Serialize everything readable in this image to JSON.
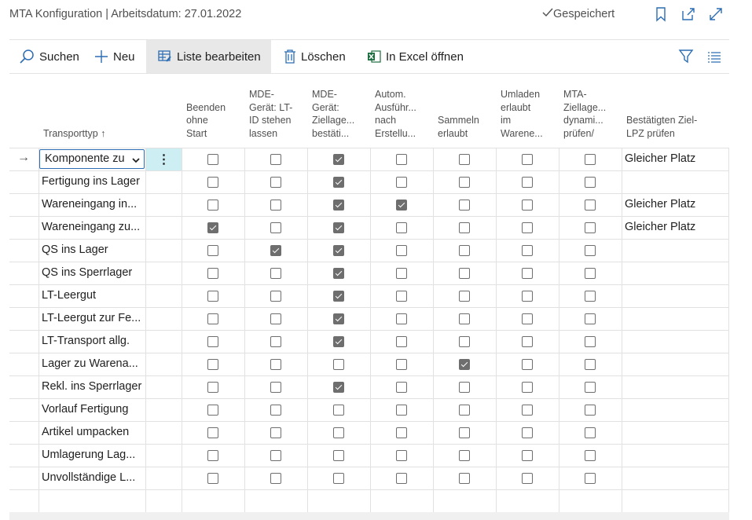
{
  "header": {
    "title": "MTA Konfiguration | Arbeitsdatum: 27.01.2022",
    "saved_status": "Gespeichert",
    "icons": [
      "bookmark-icon",
      "open-new-window-icon",
      "expand-icon"
    ]
  },
  "toolbar": {
    "search": "Suchen",
    "new": "Neu",
    "edit_list": "Liste bearbeiten",
    "delete": "Löschen",
    "excel": "In Excel öffnen",
    "right_icons": [
      "filter-icon",
      "list-options-icon"
    ]
  },
  "table": {
    "columns": [
      "Transporttyp ↑",
      "Beenden ohne Start",
      "MDE-Gerät: LT-ID stehen lassen",
      "MDE-Gerät: Ziellage... bestäti...",
      "Autom. Ausführ... nach Erstellu...",
      "Sammeln erlaubt",
      "Umladen erlaubt im Warene...",
      "MTA-Ziellage... dynami... prüfen/",
      "Bestätigten Ziel-LPZ prüfen"
    ],
    "column_header_lines": [
      [
        "Transporttyp ↑"
      ],
      [
        "Beenden",
        "ohne",
        "Start"
      ],
      [
        "MDE-",
        "Gerät: LT-",
        "ID stehen",
        "lassen"
      ],
      [
        "MDE-",
        "Gerät:",
        "Ziellage...",
        "bestäti..."
      ],
      [
        "Autom.",
        "Ausführ...",
        "nach",
        "Erstellu..."
      ],
      [
        "Sammeln",
        "erlaubt"
      ],
      [
        "Umladen",
        "erlaubt",
        "im",
        "Warene..."
      ],
      [
        "MTA-",
        "Ziellage...",
        "dynami...",
        "prüfen/"
      ],
      [
        "Bestätigten Ziel-",
        "LPZ prüfen"
      ]
    ],
    "rows": [
      {
        "type": "Komponente zu",
        "flags": [
          false,
          false,
          true,
          false,
          false,
          false,
          false
        ],
        "confirm": "Gleicher Platz",
        "selected": true
      },
      {
        "type": "Fertigung ins Lager",
        "flags": [
          false,
          false,
          true,
          false,
          false,
          false,
          false
        ],
        "confirm": ""
      },
      {
        "type": "Wareneingang in...",
        "flags": [
          false,
          false,
          true,
          true,
          false,
          false,
          false
        ],
        "confirm": "Gleicher Platz"
      },
      {
        "type": "Wareneingang zu...",
        "flags": [
          true,
          false,
          true,
          false,
          false,
          false,
          false
        ],
        "confirm": "Gleicher Platz"
      },
      {
        "type": "QS ins Lager",
        "flags": [
          false,
          true,
          true,
          false,
          false,
          false,
          false
        ],
        "confirm": ""
      },
      {
        "type": "QS ins Sperrlager",
        "flags": [
          false,
          false,
          true,
          false,
          false,
          false,
          false
        ],
        "confirm": ""
      },
      {
        "type": "LT-Leergut",
        "flags": [
          false,
          false,
          true,
          false,
          false,
          false,
          false
        ],
        "confirm": ""
      },
      {
        "type": "LT-Leergut zur Fe...",
        "flags": [
          false,
          false,
          true,
          false,
          false,
          false,
          false
        ],
        "confirm": ""
      },
      {
        "type": "LT-Transport allg.",
        "flags": [
          false,
          false,
          true,
          false,
          false,
          false,
          false
        ],
        "confirm": ""
      },
      {
        "type": "Lager zu Warena...",
        "flags": [
          false,
          false,
          false,
          false,
          true,
          false,
          false
        ],
        "confirm": ""
      },
      {
        "type": "Rekl. ins Sperrlager",
        "flags": [
          false,
          false,
          true,
          false,
          false,
          false,
          false
        ],
        "confirm": ""
      },
      {
        "type": "Vorlauf Fertigung",
        "flags": [
          false,
          false,
          false,
          false,
          false,
          false,
          false
        ],
        "confirm": ""
      },
      {
        "type": "Artikel umpacken",
        "flags": [
          false,
          false,
          false,
          false,
          false,
          false,
          false
        ],
        "confirm": ""
      },
      {
        "type": "Umlagerung Lag...",
        "flags": [
          false,
          false,
          false,
          false,
          false,
          false,
          false
        ],
        "confirm": ""
      },
      {
        "type": "Unvollständige L...",
        "flags": [
          false,
          false,
          false,
          false,
          false,
          false,
          false
        ],
        "confirm": ""
      }
    ],
    "row_menu_glyph": "⋮",
    "selected_row_marker": "→"
  },
  "colors": {
    "accent_blue": "#2c6db3",
    "excel_green": "#1d6f42",
    "active_toolbar_bg": "#e8e8e8",
    "row_menu_bg": "#cdeff4",
    "checkbox_checked": "#6e6e6e"
  }
}
